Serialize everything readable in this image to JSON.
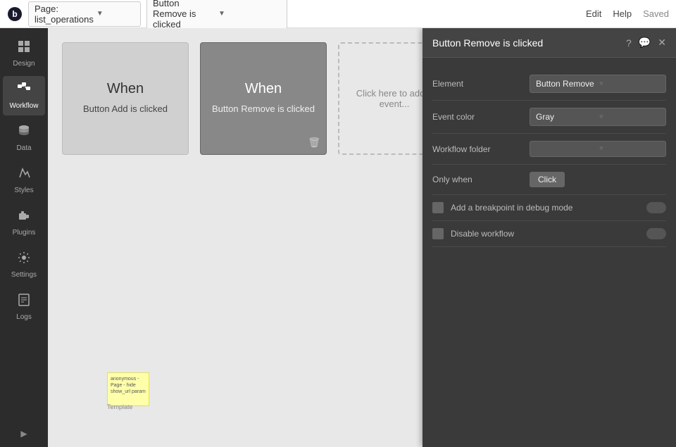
{
  "topbar": {
    "logo_text": "b",
    "page_label": "Page: list_operations",
    "event_label": "Button Remove is clicked",
    "edit_label": "Edit",
    "help_label": "Help",
    "saved_label": "Saved"
  },
  "sidebar": {
    "items": [
      {
        "id": "design",
        "label": "Design",
        "icon": "✦"
      },
      {
        "id": "workflow",
        "label": "Workflow",
        "icon": "⬛"
      },
      {
        "id": "data",
        "label": "Data",
        "icon": "🗄"
      },
      {
        "id": "styles",
        "label": "Styles",
        "icon": "✏"
      },
      {
        "id": "plugins",
        "label": "Plugins",
        "icon": "🔌"
      },
      {
        "id": "settings",
        "label": "Settings",
        "icon": "⚙"
      },
      {
        "id": "logs",
        "label": "Logs",
        "icon": "📄"
      }
    ]
  },
  "workflow": {
    "cards": [
      {
        "id": "card-add",
        "when_label": "When",
        "desc": "Button Add is clicked",
        "active": false
      },
      {
        "id": "card-remove",
        "when_label": "When",
        "desc": "Button Remove is clicked",
        "active": true
      }
    ],
    "add_event_text": "Click here to add a event..."
  },
  "panel": {
    "title": "Button Remove is clicked",
    "rows": [
      {
        "id": "element",
        "label": "Element",
        "type": "select",
        "value": "Button Remove"
      },
      {
        "id": "event_color",
        "label": "Event color",
        "type": "select",
        "value": "Gray"
      },
      {
        "id": "workflow_folder",
        "label": "Workflow folder",
        "type": "select",
        "value": ""
      },
      {
        "id": "only_when",
        "label": "Only when",
        "type": "click_btn",
        "btn_label": "Click"
      }
    ],
    "checkboxes": [
      {
        "id": "breakpoint",
        "label": "Add a breakpoint in debug mode"
      },
      {
        "id": "disable",
        "label": "Disable workflow"
      }
    ]
  },
  "template": {
    "note_text": "anonymous - Page - hide show_url param",
    "label": "Template"
  }
}
